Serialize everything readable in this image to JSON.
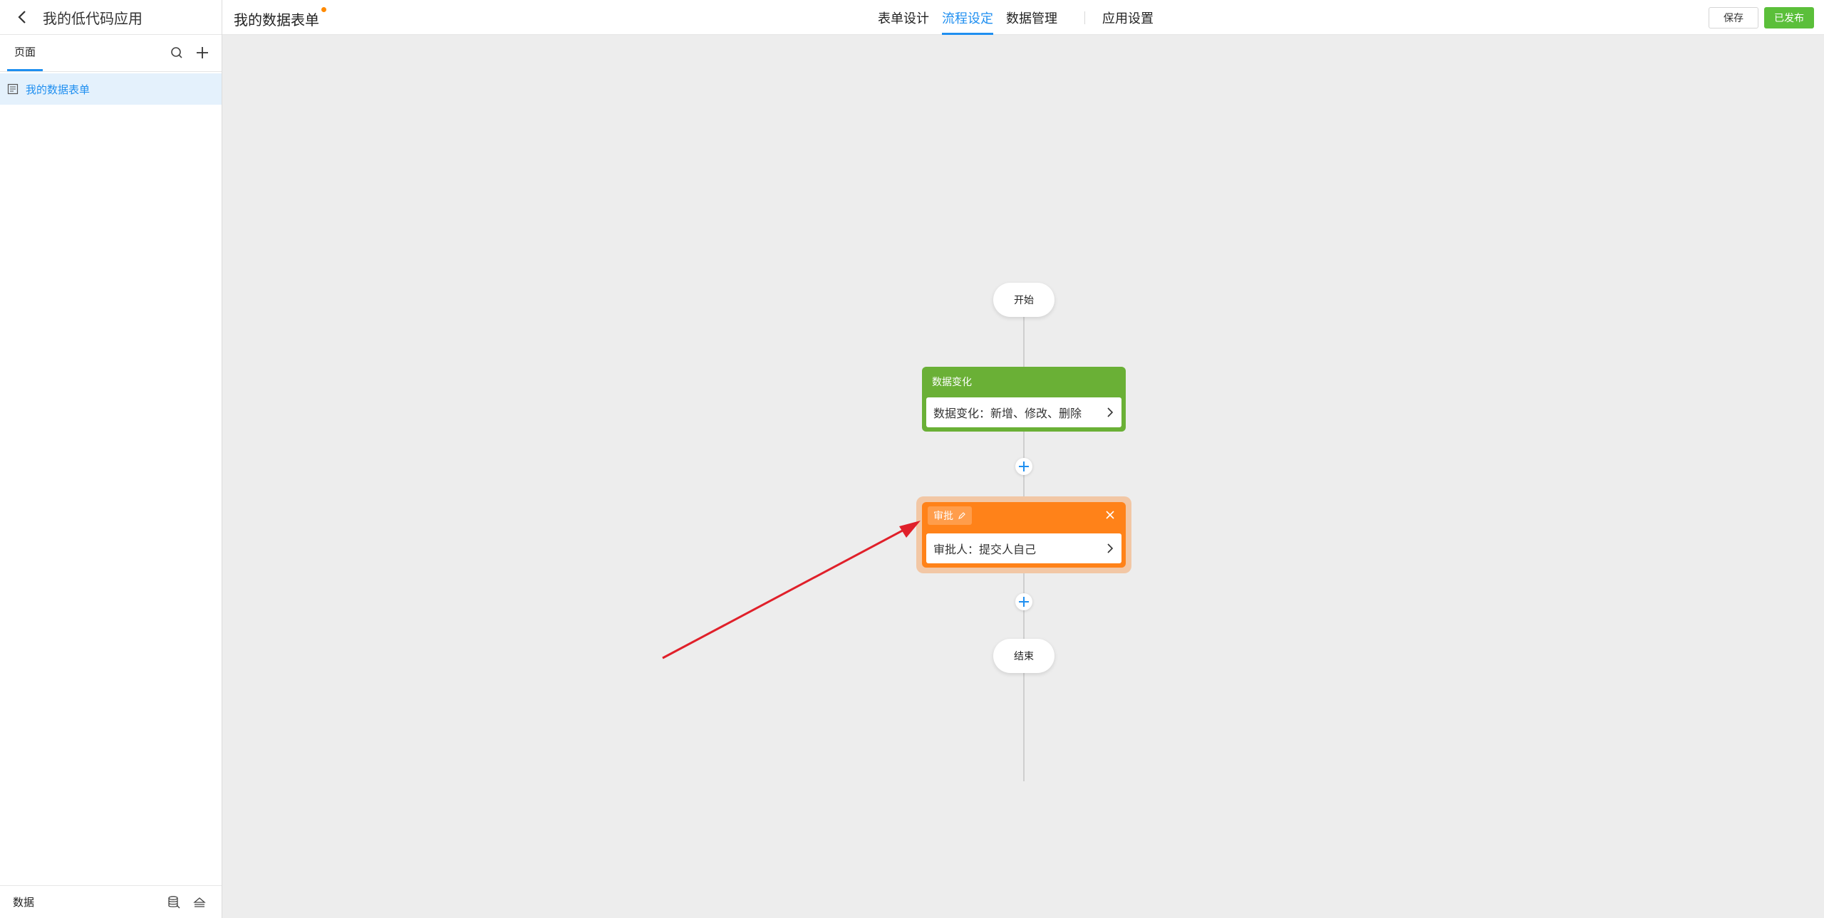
{
  "sidebar": {
    "app_title": "我的低代码应用",
    "tab_label": "页面",
    "pages": [
      {
        "label": "我的数据表单"
      }
    ],
    "footer_label": "数据"
  },
  "header": {
    "form_title": "我的数据表单",
    "nav": [
      {
        "label": "表单设计"
      },
      {
        "label": "流程设定"
      },
      {
        "label": "数据管理"
      },
      {
        "label": "应用设置"
      }
    ],
    "active_nav": "流程设定",
    "save_label": "保存",
    "publish_label": "已发布"
  },
  "flow": {
    "start_label": "开始",
    "data_change_node": {
      "title": "数据变化",
      "body": "数据变化：新增、修改、删除"
    },
    "approval_node": {
      "title": "审批",
      "body": "审批人：提交人自己"
    },
    "end_label": "结束"
  },
  "colors": {
    "accent": "#1f8ff0",
    "publish": "#5bbf3a",
    "data_node": "#6ab036",
    "approval_node": "#ff8219",
    "arrow": "#e0202a"
  }
}
